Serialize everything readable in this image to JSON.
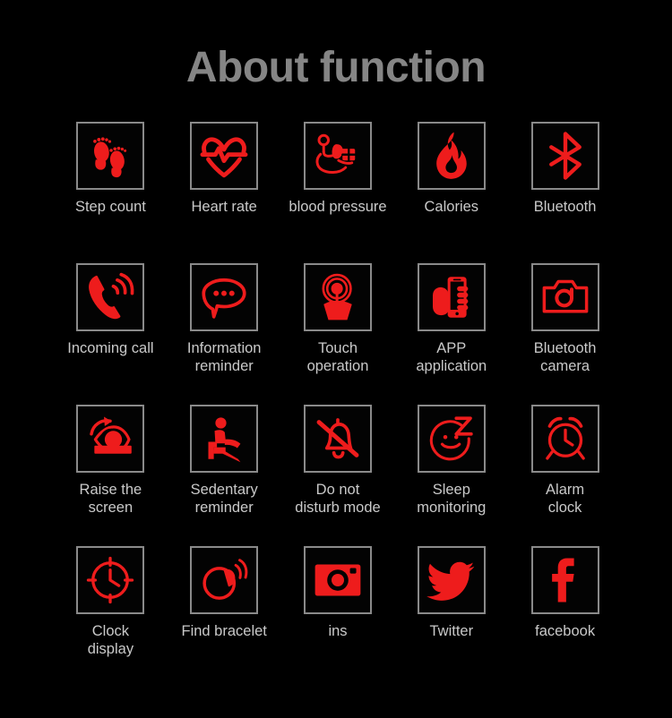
{
  "page": {
    "title": "About function",
    "background_color": "#000000",
    "title_color": "#858585",
    "label_color": "#c9c9c9",
    "icon_color": "#ee1c1c",
    "icon_border_color": "#8a8a8a"
  },
  "features": [
    {
      "label": "Step count",
      "icon": "footprints-icon"
    },
    {
      "label": "Heart rate",
      "icon": "heart-pulse-icon"
    },
    {
      "label": "blood pressure",
      "icon": "blood-pressure-monitor-icon"
    },
    {
      "label": "Calories",
      "icon": "flame-icon"
    },
    {
      "label": "Bluetooth",
      "icon": "bluetooth-icon"
    },
    {
      "label": "Incoming call",
      "icon": "phone-ringing-icon"
    },
    {
      "label": "Information\nreminder",
      "icon": "speech-bubble-icon"
    },
    {
      "label": "Touch\noperation",
      "icon": "touch-hand-icon"
    },
    {
      "label": "APP\napplication",
      "icon": "hand-holding-phone-icon"
    },
    {
      "label": "Bluetooth\ncamera",
      "icon": "camera-icon"
    },
    {
      "label": "Raise the\nscreen",
      "icon": "eye-rotate-icon"
    },
    {
      "label": "Sedentary\nreminder",
      "icon": "seated-person-icon"
    },
    {
      "label": "Do not\ndisturb mode",
      "icon": "bell-muted-icon"
    },
    {
      "label": "Sleep\nmonitoring",
      "icon": "sleeping-face-icon"
    },
    {
      "label": "Alarm\nclock",
      "icon": "alarm-clock-icon"
    },
    {
      "label": "Clock\ndisplay",
      "icon": "clock-icon"
    },
    {
      "label": "Find bracelet",
      "icon": "bracelet-vibrate-icon"
    },
    {
      "label": "ins",
      "icon": "instagram-icon"
    },
    {
      "label": "Twitter",
      "icon": "twitter-bird-icon"
    },
    {
      "label": "facebook",
      "icon": "facebook-f-icon"
    }
  ]
}
